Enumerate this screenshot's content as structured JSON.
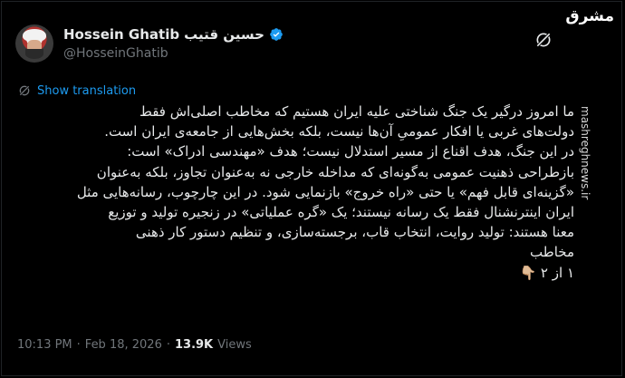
{
  "watermark": {
    "logo": "مشرق",
    "site": "mashreghnews.ir"
  },
  "author": {
    "name_en": "Hossein Ghatib",
    "name_fa": "حسین قتیب",
    "handle": "@HosseinGhatib",
    "verified": true
  },
  "translation": {
    "label": "Show translation"
  },
  "tweet": {
    "lines": [
      "ما امروز درگیر یک جنگ شناختی علیه ایران هستیم که مخاطب اصلی‌اش فقط",
      "دولت‌های غربی یا افکار عمومیِ آن‌ها نیست، بلکه بخش‌هایی از جامعه‌ی ایران است.",
      "در این جنگ، هدف اقناع از مسیر استدلال نیست؛ هدف «مهندسی ادراک» است:",
      "بازطراحی ذهنیت عمومی به‌گونه‌ای که مداخله خارجی نه به‌عنوان تجاوز، بلکه به‌عنوان",
      "«گزینه‌ای قابل فهم» یا حتی «راه خروج» بازنمایی شود. در این چارچوب، رسانه‌هایی مثل",
      "ایران اینترنشنال فقط یک رسانه نیستند؛ یک «گره عملیاتی» در زنجیره تولید و توزیع",
      "معنا هستند: تولید روایت، انتخاب قاب، برجسته‌سازی، و تنظیم دستور کار ذهنی",
      "مخاطب",
      "۱ از ۲ 👇🏼"
    ]
  },
  "meta": {
    "time": "10:13 PM",
    "sep": "·",
    "date": "Feb 18, 2026",
    "views_count": "13.9K",
    "views_label": "Views"
  }
}
